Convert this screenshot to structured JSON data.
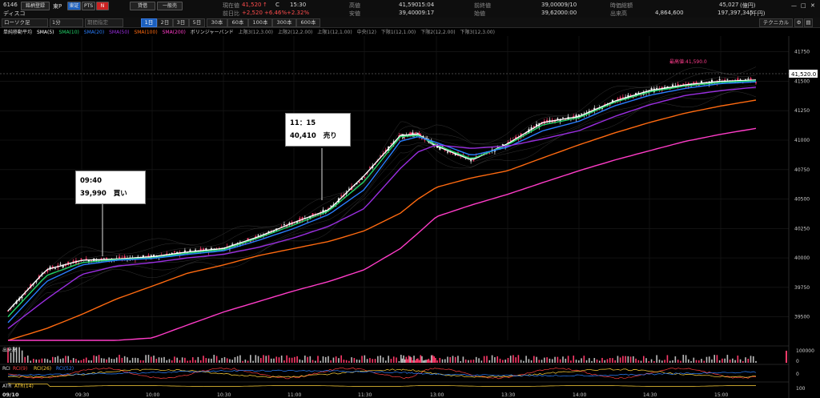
{
  "header": {
    "code": "6146",
    "name": "ディスコ",
    "reg_button": "銘柄登録",
    "market": "東P",
    "venue_tabs": [
      "東証",
      "PTS"
    ],
    "credit": "貸借",
    "type": "一般売",
    "stats_left": [
      {
        "label": "現在値",
        "value": "41,520",
        "extra": "↑",
        "tag": "C",
        "time": "15:30"
      },
      {
        "label": "前日比",
        "value": "+2,520",
        "pct1": "+6.46%",
        "pct2": "+2.32%"
      }
    ],
    "stats_mid": [
      {
        "label": "高値",
        "value": "41,590",
        "time": "15:04"
      },
      {
        "label": "安値",
        "value": "39,400",
        "time": "09:17"
      }
    ],
    "stats_mid2": [
      {
        "label": "前終値",
        "value": "39,000",
        "time": "09/10"
      },
      {
        "label": "始値",
        "value": "39,620",
        "time": "00:00"
      }
    ],
    "stats_right": [
      {
        "label": "時価総額",
        "value": "45,027",
        "unit": "(億円)"
      },
      {
        "label": "出来高",
        "value": "4,864,600",
        "value2": "197,397,345",
        "unit": "(千円)"
      }
    ]
  },
  "toolbar": {
    "chart_type": "ローソク足",
    "interval": "1分",
    "period_placeholder": "期間指定",
    "tabs": [
      "1日",
      "2日",
      "3日",
      "5日",
      "30本",
      "60本",
      "100本",
      "300本",
      "600本"
    ],
    "active_tab": "1日",
    "technical": "テクニカル"
  },
  "legend": {
    "title": "単純移動平均",
    "items": [
      {
        "label": "SMA(5)",
        "color": "#ffffff"
      },
      {
        "label": "SMA(10)",
        "color": "#22d46a"
      },
      {
        "label": "SMA(20)",
        "color": "#2a7fff"
      },
      {
        "label": "SMA(50)",
        "color": "#9a2ee0"
      },
      {
        "label": "SMA(100)",
        "color": "#ff6a10"
      },
      {
        "label": "SMA(200)",
        "color": "#ff3cc8"
      }
    ],
    "bollinger": "ボリンジャーバンド",
    "bands": [
      "上限3(12,3.00)",
      "上限2(12,2.00)",
      "上限1(12,1.00)",
      "中央(12)",
      "下限1(12,1.00)",
      "下限2(12,2.00)",
      "下限3(12,3.00)"
    ]
  },
  "chart_data": {
    "type": "line",
    "x": [
      "09:00",
      "09:15",
      "09:30",
      "09:45",
      "10:00",
      "10:15",
      "10:30",
      "10:45",
      "11:00",
      "11:15",
      "11:30",
      "12:30",
      "12:45",
      "13:00",
      "13:15",
      "13:30",
      "13:45",
      "14:00",
      "14:15",
      "14:30",
      "14:45",
      "15:00",
      "15:15"
    ],
    "xticks": [
      "09:30",
      "10:00",
      "10:30",
      "11:00",
      "11:30",
      "13:00",
      "13:30",
      "14:00",
      "14:30",
      "15:00"
    ],
    "date_label": "09/10",
    "yticks": [
      39500,
      39750,
      40000,
      40250,
      40500,
      40750,
      41000,
      41250,
      41500,
      41750
    ],
    "ylim": [
      39300,
      41850
    ],
    "series": [
      {
        "name": "SMA(5)",
        "color": "#ffffff",
        "values": [
          39550,
          39900,
          39980,
          39990,
          40010,
          40050,
          40080,
          40180,
          40300,
          40410,
          40700,
          41040,
          41050,
          40950,
          40830,
          40970,
          41150,
          41200,
          41330,
          41420,
          41470,
          41500,
          41510
        ]
      },
      {
        "name": "SMA(10)",
        "color": "#22d46a",
        "values": [
          39500,
          39850,
          39960,
          39985,
          40000,
          40040,
          40070,
          40170,
          40280,
          40400,
          40650,
          41030,
          41040,
          40960,
          40840,
          40960,
          41130,
          41190,
          41320,
          41410,
          41460,
          41490,
          41505
        ]
      },
      {
        "name": "SMA(20)",
        "color": "#2a7fff",
        "values": [
          39450,
          39800,
          39940,
          39980,
          39995,
          40030,
          40060,
          40150,
          40250,
          40370,
          40580,
          40990,
          41030,
          40980,
          40870,
          40940,
          41080,
          41160,
          41290,
          41380,
          41440,
          41480,
          41495
        ]
      },
      {
        "name": "SMA(50)",
        "color": "#9a2ee0",
        "values": [
          39400,
          39650,
          39860,
          39930,
          39960,
          40000,
          40030,
          40090,
          40170,
          40270,
          40420,
          40760,
          40900,
          40960,
          40930,
          40950,
          41010,
          41080,
          41200,
          41300,
          41380,
          41420,
          41450
        ]
      },
      {
        "name": "SMA(100)",
        "color": "#ff6a10",
        "values": [
          39300,
          39400,
          39520,
          39650,
          39760,
          39870,
          39940,
          40020,
          40080,
          40140,
          40230,
          40380,
          40500,
          40600,
          40680,
          40740,
          40850,
          40960,
          41060,
          41150,
          41230,
          41290,
          41340
        ]
      },
      {
        "name": "SMA(200)",
        "color": "#ff3cc8",
        "values": [
          39300,
          39300,
          39300,
          39300,
          39320,
          39430,
          39540,
          39630,
          39720,
          39800,
          39900,
          40080,
          40210,
          40350,
          40450,
          40540,
          40640,
          40740,
          40830,
          40910,
          40990,
          41050,
          41100
        ]
      }
    ],
    "annotations": [
      {
        "time": "09:40",
        "price": "39,990",
        "action": "買い"
      },
      {
        "time": "11：15",
        "price": "40,410",
        "action": "売り"
      }
    ],
    "high_marker": "最高値:41,590.0",
    "price_label": "41,520.0",
    "volume_label": "出来高",
    "volume_axis": [
      "100000",
      "0"
    ],
    "rci_label": "RCI",
    "rci_items": [
      "RCI(9)",
      "RCI(26)",
      "RCI(52)"
    ],
    "rci_axis": "0",
    "atr_label": "ATR",
    "atr_item": "ATR(14)",
    "atr_axis": "100"
  }
}
